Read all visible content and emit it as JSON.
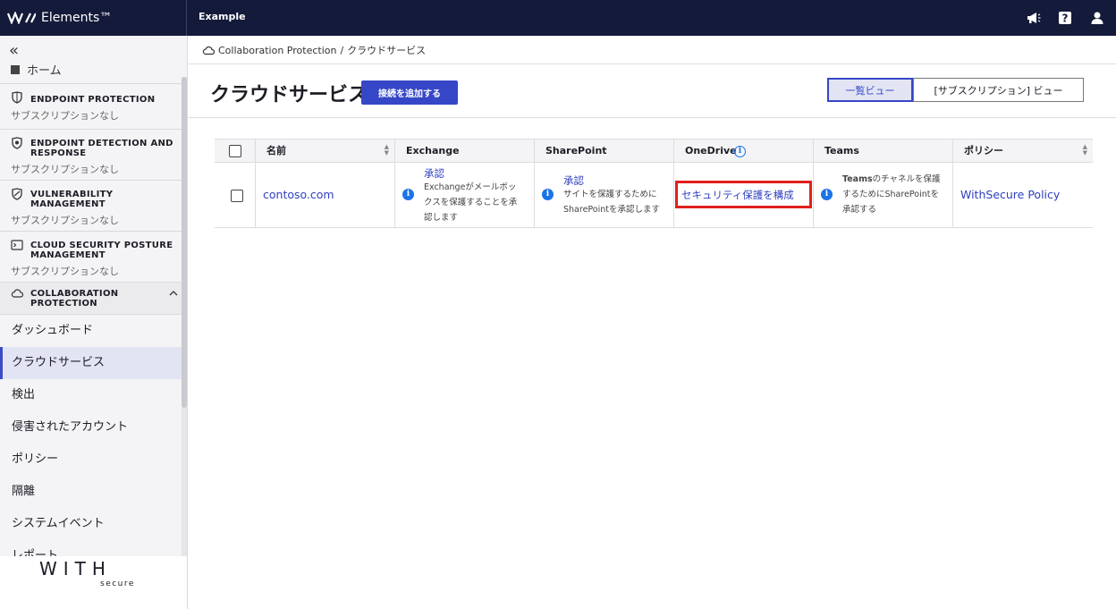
{
  "app": {
    "brand": "Elements™",
    "org": "Example"
  },
  "colors": {
    "topbar": "#141a3a",
    "accent": "#3547c6",
    "link": "#2f3fbf",
    "info": "#1a73e8",
    "highlight": "#e0201c"
  },
  "sidebar": {
    "top_partial_label": "ホーム",
    "products": [
      {
        "title": "ENDPOINT PROTECTION",
        "sub": "サブスクリプションなし",
        "icon": "shield-icon"
      },
      {
        "title": "ENDPOINT DETECTION AND RESPONSE",
        "sub": "サブスクリプションなし",
        "icon": "detection-icon"
      },
      {
        "title": "VULNERABILITY MANAGEMENT",
        "sub": "サブスクリプションなし",
        "icon": "vulnerability-icon"
      },
      {
        "title": "CLOUD SECURITY POSTURE MANAGEMENT",
        "sub": "サブスクリプションなし",
        "icon": "terminal-icon"
      },
      {
        "title": "COLLABORATION PROTECTION",
        "icon": "cloud-icon"
      }
    ],
    "items": [
      {
        "label": "ダッシュボード"
      },
      {
        "label": "クラウドサービス",
        "active": true
      },
      {
        "label": "検出"
      },
      {
        "label": "侵害されたアカウント"
      },
      {
        "label": "ポリシー"
      },
      {
        "label": "隔離"
      },
      {
        "label": "システムイベント"
      },
      {
        "label": "レポート"
      }
    ],
    "footer_logo": {
      "word": "WITH",
      "sub": "secure"
    }
  },
  "breadcrumb": {
    "parent": "Collaboration Protection",
    "separator": "/",
    "current": "クラウドサービス"
  },
  "page": {
    "title": "クラウドサービス",
    "add_button": "接続を追加する",
    "views": [
      "一覧ビュー",
      "[サブスクリプション] ビュー"
    ]
  },
  "table": {
    "headers": [
      "名前",
      "Exchange",
      "SharePoint",
      "OneDrive",
      "Teams",
      "ポリシー"
    ],
    "row": {
      "name": "contoso.com",
      "exchange": {
        "title": "承認",
        "desc1": "Exchangeがメールボッ",
        "desc2": "クスを保護することを承",
        "desc3": "認します"
      },
      "sharepoint": {
        "title": "承認",
        "desc1": "サイトを保護するために",
        "desc2": "SharePointを承認します"
      },
      "onedrive": {
        "link": "セキュリティ保護を構成"
      },
      "teams": {
        "title": "Teams",
        "desc1": "のチャネルを保護",
        "desc2": "するためにSharePointを",
        "desc3": "承認する"
      },
      "policy": "WithSecure Policy"
    }
  }
}
